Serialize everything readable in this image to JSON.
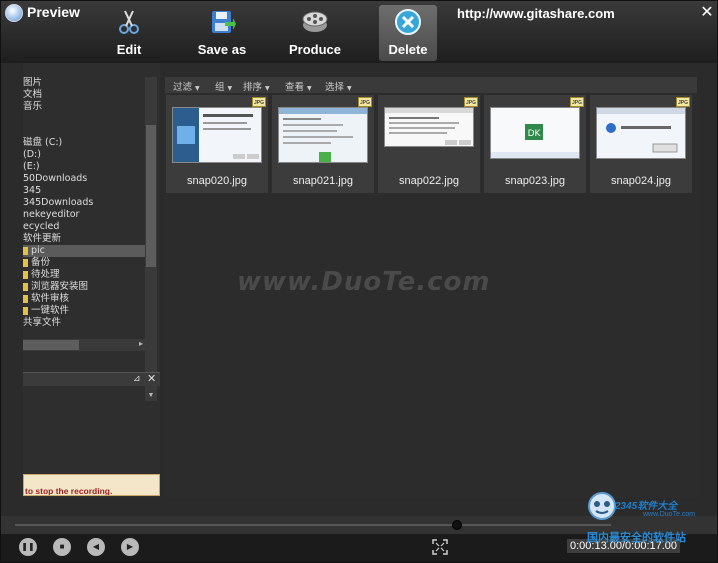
{
  "window": {
    "title": "Preview",
    "url": "http://www.gitashare.com",
    "close_glyph": "✕"
  },
  "toolbar": [
    {
      "label": "Edit",
      "icon": "scissors-icon"
    },
    {
      "label": "Save as",
      "icon": "save-icon"
    },
    {
      "label": "Produce",
      "icon": "film-reel-icon"
    },
    {
      "label": "Delete",
      "icon": "delete-icon",
      "active": true
    }
  ],
  "tree": {
    "items": [
      {
        "label": "图片"
      },
      {
        "label": "文档"
      },
      {
        "label": "音乐"
      },
      {
        "label": ""
      },
      {
        "label": ""
      },
      {
        "label": "磁盘 (C:)"
      },
      {
        "label": "(D:)"
      },
      {
        "label": "(E:)"
      },
      {
        "label": "50Downloads"
      },
      {
        "label": "345"
      },
      {
        "label": "345Downloads"
      },
      {
        "label": "nekeyeditor"
      },
      {
        "label": "ecycled"
      },
      {
        "label": "软件更新"
      },
      {
        "label": "pic",
        "selected": true,
        "folder": true
      },
      {
        "label": "备份",
        "folder": true
      },
      {
        "label": "待处理",
        "folder": true
      },
      {
        "label": "浏览器安装图",
        "folder": true
      },
      {
        "label": "软件审核",
        "folder": true
      },
      {
        "label": "一键软件",
        "folder": true
      },
      {
        "label": "共享文件"
      }
    ]
  },
  "panel2": {
    "pin_glyph": "⊿",
    "close_glyph": "✕"
  },
  "hint": "to stop the recording.",
  "explorer_menu": [
    "过滤",
    "组",
    "排序",
    "查看",
    "选择"
  ],
  "thumbnails": [
    {
      "name": "snap020.jpg",
      "badge": "JPG"
    },
    {
      "name": "snap021.jpg",
      "badge": "JPG"
    },
    {
      "name": "snap022.jpg",
      "badge": "JPG"
    },
    {
      "name": "snap023.jpg",
      "badge": "JPG"
    },
    {
      "name": "snap024.jpg",
      "badge": "JPG"
    }
  ],
  "watermark": "www.DuoTe.com",
  "playback": {
    "progress": 0.75,
    "timecode": "0:00:13.00/0:00:17.00",
    "buttons": [
      {
        "icon": "pause-icon",
        "glyph": "❚❚"
      },
      {
        "icon": "stop-icon",
        "glyph": "■"
      },
      {
        "icon": "previous-icon",
        "glyph": "◀"
      },
      {
        "icon": "next-icon",
        "glyph": "▶"
      }
    ]
  },
  "branding": {
    "name": "2345软件大全",
    "url": "www.DuoTe.com",
    "slogan": "国内最安全的软件站"
  },
  "colors": {
    "accent_active": "#5d5d5d",
    "delete_icon": "#39a6d8",
    "brand_blue": "#1f7ec9"
  }
}
